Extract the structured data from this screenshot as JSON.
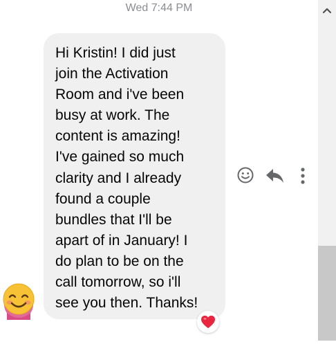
{
  "conversation": {
    "timestamp": "Wed 7:44 PM"
  },
  "message": {
    "text": "Hi Kristin! I did just\njoin the Activation\nRoom and i've been\nbusy at work. The\ncontent is amazing!\nI've gained so much\nclarity and I already\nfound a couple\nbundles that I'll be\napart of in January! I\ndo plan to be on the\ncall tomorrow, so i'll\nsee you then. Thanks!",
    "bubble_color": "#f0f0f0",
    "reaction": "heart",
    "reaction_color": "#e8263f"
  },
  "actions": {
    "icons": [
      "smiley-icon",
      "reply-icon",
      "more-options-icon"
    ]
  },
  "colors": {
    "timestamp": "#8a8d91",
    "icon": "#65676b",
    "scrollbar_track": "#f1f1f1",
    "scrollbar_thumb": "#c8c8c8"
  }
}
